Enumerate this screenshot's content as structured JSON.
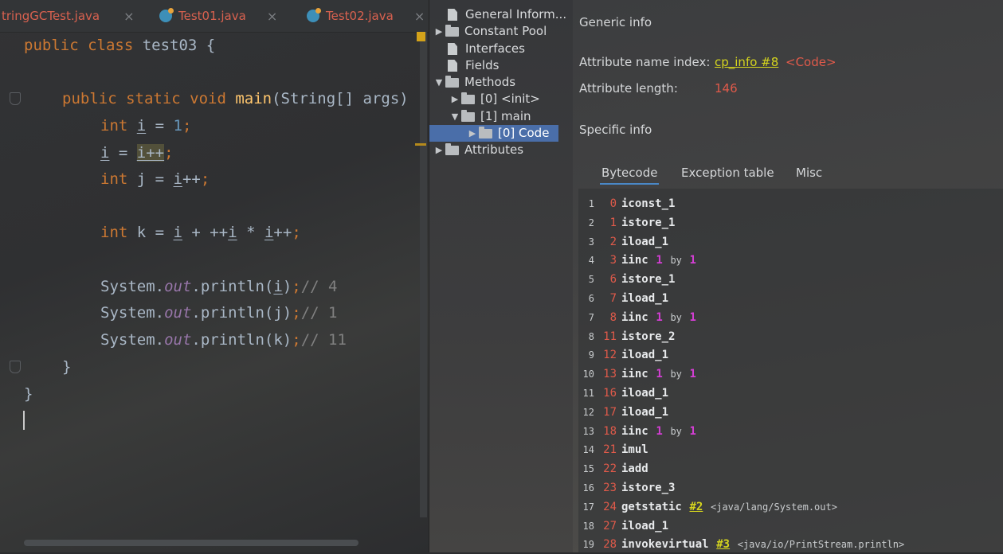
{
  "editor": {
    "tabs": [
      {
        "label": "tringGCTest.java",
        "icon": "none"
      },
      {
        "label": "Test01.java",
        "icon": "java-class-icon"
      },
      {
        "label": "Test02.java",
        "icon": "java-class-icon"
      }
    ],
    "close_glyph": "×",
    "code": {
      "l1_kw": "public class ",
      "l1_rest": "test03 {",
      "l3_kw": "public static void ",
      "l3_fn": "main",
      "l3_rest": "(String[] args)",
      "l4_kw": "int ",
      "l4_var": "i",
      "l4_eq": " = ",
      "l4_num": "1",
      "l4_semi": ";",
      "l5_var": "i",
      "l5_eq": " = ",
      "l5_hl": "i++",
      "l5_semi": ";",
      "l6_kw": "int ",
      "l6_j": "j = ",
      "l6_var": "i",
      "l6_pp": "++",
      "l6_semi": ";",
      "l8_kw": "int ",
      "l8_k": "k = ",
      "l8_v1": "i",
      "l8_mid": " + ++",
      "l8_v2": "i",
      "l8_mul": " * ",
      "l8_v3": "i",
      "l8_pp": "++",
      "l8_semi": ";",
      "l10_sys": "System.",
      "l10_out": "out",
      "l10_pr": ".println(",
      "l10_var": "i",
      "l10_close": ")",
      "l10_semi": ";",
      "l10_cmt": "// 4",
      "l11_sys": "System.",
      "l11_out": "out",
      "l11_pr": ".println(j)",
      "l11_semi": ";",
      "l11_cmt": "// 1",
      "l12_sys": "System.",
      "l12_out": "out",
      "l12_pr": ".println(k)",
      "l12_semi": ";",
      "l12_cmt": "// 11",
      "l13": "}",
      "l14": "}"
    }
  },
  "tree": {
    "items": [
      {
        "label": "General Inform...",
        "type": "file"
      },
      {
        "label": "Constant Pool",
        "type": "folder",
        "arrow": "▶"
      },
      {
        "label": "Interfaces",
        "type": "file"
      },
      {
        "label": "Fields",
        "type": "file"
      },
      {
        "label": "Methods",
        "type": "folder",
        "arrow": "▼"
      },
      {
        "label": "[0] <init>",
        "type": "folder",
        "arrow": "▶"
      },
      {
        "label": "[1] main",
        "type": "folder",
        "arrow": "▼"
      },
      {
        "label": "[0] Code",
        "type": "folder",
        "arrow": "▶",
        "selected": true
      },
      {
        "label": "Attributes",
        "type": "folder",
        "arrow": "▶"
      }
    ]
  },
  "detail": {
    "generic_title": "Generic info",
    "attr_name_label": "Attribute name index:",
    "attr_name_link": "cp_info #8",
    "attr_name_value": "<Code>",
    "attr_len_label": "Attribute length:",
    "attr_len_value": "146",
    "specific_title": "Specific info",
    "tabs": [
      "Bytecode",
      "Exception table",
      "Misc"
    ],
    "active_tab": "Bytecode",
    "by_word": "by",
    "bytecode": [
      {
        "idx": "1",
        "off": "0",
        "op": "iconst_1"
      },
      {
        "idx": "2",
        "off": "1",
        "op": "istore_1"
      },
      {
        "idx": "3",
        "off": "2",
        "op": "iload_1"
      },
      {
        "idx": "4",
        "off": "3",
        "op": "iinc",
        "a": "1",
        "b": "1"
      },
      {
        "idx": "5",
        "off": "6",
        "op": "istore_1"
      },
      {
        "idx": "6",
        "off": "7",
        "op": "iload_1"
      },
      {
        "idx": "7",
        "off": "8",
        "op": "iinc",
        "a": "1",
        "b": "1"
      },
      {
        "idx": "8",
        "off": "11",
        "op": "istore_2"
      },
      {
        "idx": "9",
        "off": "12",
        "op": "iload_1"
      },
      {
        "idx": "10",
        "off": "13",
        "op": "iinc",
        "a": "1",
        "b": "1"
      },
      {
        "idx": "11",
        "off": "16",
        "op": "iload_1"
      },
      {
        "idx": "12",
        "off": "17",
        "op": "iload_1"
      },
      {
        "idx": "13",
        "off": "18",
        "op": "iinc",
        "a": "1",
        "b": "1"
      },
      {
        "idx": "14",
        "off": "21",
        "op": "imul"
      },
      {
        "idx": "15",
        "off": "22",
        "op": "iadd"
      },
      {
        "idx": "16",
        "off": "23",
        "op": "istore_3"
      },
      {
        "idx": "17",
        "off": "24",
        "op": "getstatic",
        "ref": "#2",
        "cmt": "<java/lang/System.out>"
      },
      {
        "idx": "18",
        "off": "27",
        "op": "iload_1"
      },
      {
        "idx": "19",
        "off": "28",
        "op": "invokevirtual",
        "ref": "#3",
        "cmt": "<java/io/PrintStream.println>"
      }
    ]
  }
}
